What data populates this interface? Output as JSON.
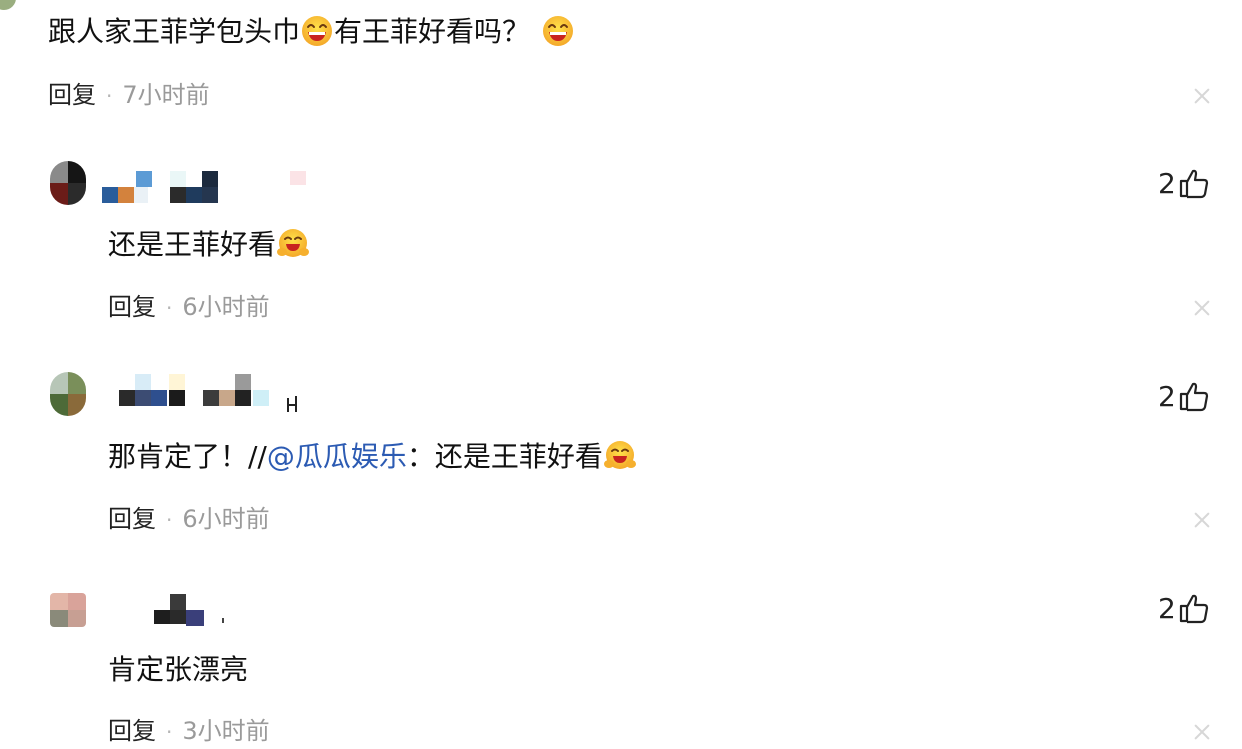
{
  "comments": [
    {
      "text_a": "跟人家王菲学包头巾",
      "text_b": "有王菲好看吗？",
      "reply_label": "回复",
      "time": "7小时前",
      "emoji": "grinning-face-icon"
    },
    {
      "text": "还是王菲好看",
      "reply_label": "回复",
      "time": "6小时前",
      "likes": "2",
      "emoji": "hugging-face-icon"
    },
    {
      "text_prefix": "那肯定了！//",
      "mention": "@瓜瓜娱乐",
      "text_suffix": "：还是王菲好看",
      "reply_label": "回复",
      "time": "6小时前",
      "likes": "2",
      "emoji": "hugging-face-icon"
    },
    {
      "text": "肯定张漂亮",
      "reply_label": "回复",
      "time": "3小时前",
      "likes": "2"
    }
  ],
  "colors": {
    "mention": "#2c5bb3",
    "time": "#9a9a9a",
    "close": "#d7d7d7"
  }
}
